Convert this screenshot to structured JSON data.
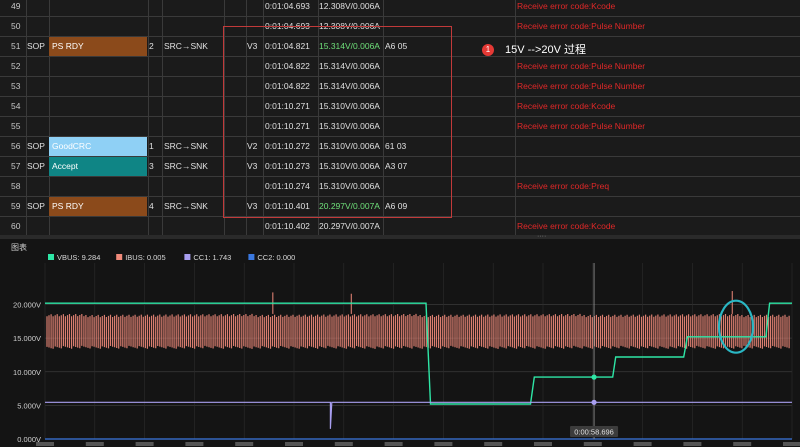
{
  "table": {
    "rows": [
      {
        "num": "49",
        "time": "0:01:04.693",
        "vi": "12.308V/0.006A",
        "err": "Receive error code:Kcode"
      },
      {
        "num": "50",
        "time": "0:01:04.693",
        "vi": "12.308V/0.006A",
        "err": "Receive error code:Pulse Number"
      },
      {
        "num": "51",
        "sop": "SOP",
        "msg": "PS RDY",
        "msg_color": "#8b4a1b",
        "idx": "2",
        "dir": "SRC→SNK",
        "ver": "V3",
        "time": "0:01:04.821",
        "vi": "15.314V/0.006A",
        "vi_green": true,
        "raw": "A6 05"
      },
      {
        "num": "52",
        "time": "0:01:04.822",
        "vi": "15.314V/0.006A",
        "err": "Receive error code:Pulse Number"
      },
      {
        "num": "53",
        "time": "0:01:04.822",
        "vi": "15.314V/0.006A",
        "err": "Receive error code:Pulse Number"
      },
      {
        "num": "54",
        "time": "0:01:10.271",
        "vi": "15.310V/0.006A",
        "err": "Receive error code:Kcode"
      },
      {
        "num": "55",
        "time": "0:01:10.271",
        "vi": "15.310V/0.006A",
        "err": "Receive error code:Pulse Number"
      },
      {
        "num": "56",
        "sop": "SOP",
        "msg": "GoodCRC",
        "msg_color": "#8fd0f5",
        "idx": "1",
        "dir": "SRC→SNK",
        "ver": "V2",
        "time": "0:01:10.272",
        "vi": "15.310V/0.006A",
        "raw": "61 03"
      },
      {
        "num": "57",
        "sop": "SOP",
        "msg": "Accept",
        "msg_color": "#0f8585",
        "idx": "3",
        "dir": "SRC→SNK",
        "ver": "V3",
        "time": "0:01:10.273",
        "vi": "15.310V/0.006A",
        "raw": "A3 07"
      },
      {
        "num": "58",
        "time": "0:01:10.274",
        "vi": "15.310V/0.006A",
        "err": "Receive error code:Preq"
      },
      {
        "num": "59",
        "sop": "SOP",
        "msg": "PS RDY",
        "msg_color": "#8b4a1b",
        "idx": "4",
        "dir": "SRC→SNK",
        "ver": "V3",
        "time": "0:01:10.401",
        "vi": "20.297V/0.007A",
        "vi_green": true,
        "raw": "A6 09"
      },
      {
        "num": "60",
        "time": "0:01:10.402",
        "vi": "20.297V/0.007A",
        "err": "Receive error code:Kcode"
      }
    ]
  },
  "annotation": {
    "badge": "1",
    "text": "15V -->20V 过程",
    "color": "#e53935"
  },
  "chart": {
    "panel_title": "图表",
    "legend": [
      {
        "label": "VBUS: 9.284",
        "color": "#2ee6a6"
      },
      {
        "label": "IBUS: 0.005",
        "color": "#f08a7a"
      },
      {
        "label": "CC1: 1.743",
        "color": "#a89ef0"
      },
      {
        "label": "CC2: 0.000",
        "color": "#3a78e0"
      }
    ],
    "cursor_label": "0:00:58.696",
    "highlight_color": "#2ab7c4"
  },
  "chart_data": {
    "type": "line",
    "y_ticks": [
      "20.000V",
      "15.000V",
      "10.000V",
      "5.000V",
      "0.000V"
    ],
    "ylim": [
      0,
      21
    ],
    "xlim": [
      0,
      100
    ],
    "grid": true,
    "series": [
      {
        "name": "VBUS",
        "color": "#2ee6a6",
        "points": [
          [
            0,
            20.2
          ],
          [
            51,
            20.2
          ],
          [
            51.6,
            5.2
          ],
          [
            65,
            5.2
          ],
          [
            65.5,
            9.2
          ],
          [
            76,
            9.2
          ],
          [
            76.4,
            12.2
          ],
          [
            85.5,
            12.2
          ],
          [
            86,
            15.2
          ],
          [
            96.5,
            15.2
          ],
          [
            97,
            20.2
          ],
          [
            100,
            20.2
          ]
        ]
      },
      {
        "name": "IBUS",
        "color": "#f08a7a",
        "band": [
          13.4,
          18.6
        ],
        "spikes": [
          [
            30.5,
            21.8
          ],
          [
            41,
            21.6
          ],
          [
            92,
            22.0
          ]
        ]
      },
      {
        "name": "CC1",
        "color": "#a89ef0",
        "points": [
          [
            0,
            5.45
          ],
          [
            38.2,
            5.45
          ],
          [
            38.2,
            1.5
          ],
          [
            38.4,
            5.45
          ],
          [
            100,
            5.45
          ]
        ]
      },
      {
        "name": "CC2",
        "color": "#3a78e0",
        "points": [
          [
            0,
            0
          ],
          [
            100,
            0
          ]
        ]
      }
    ],
    "cursor_x": 73.5
  }
}
